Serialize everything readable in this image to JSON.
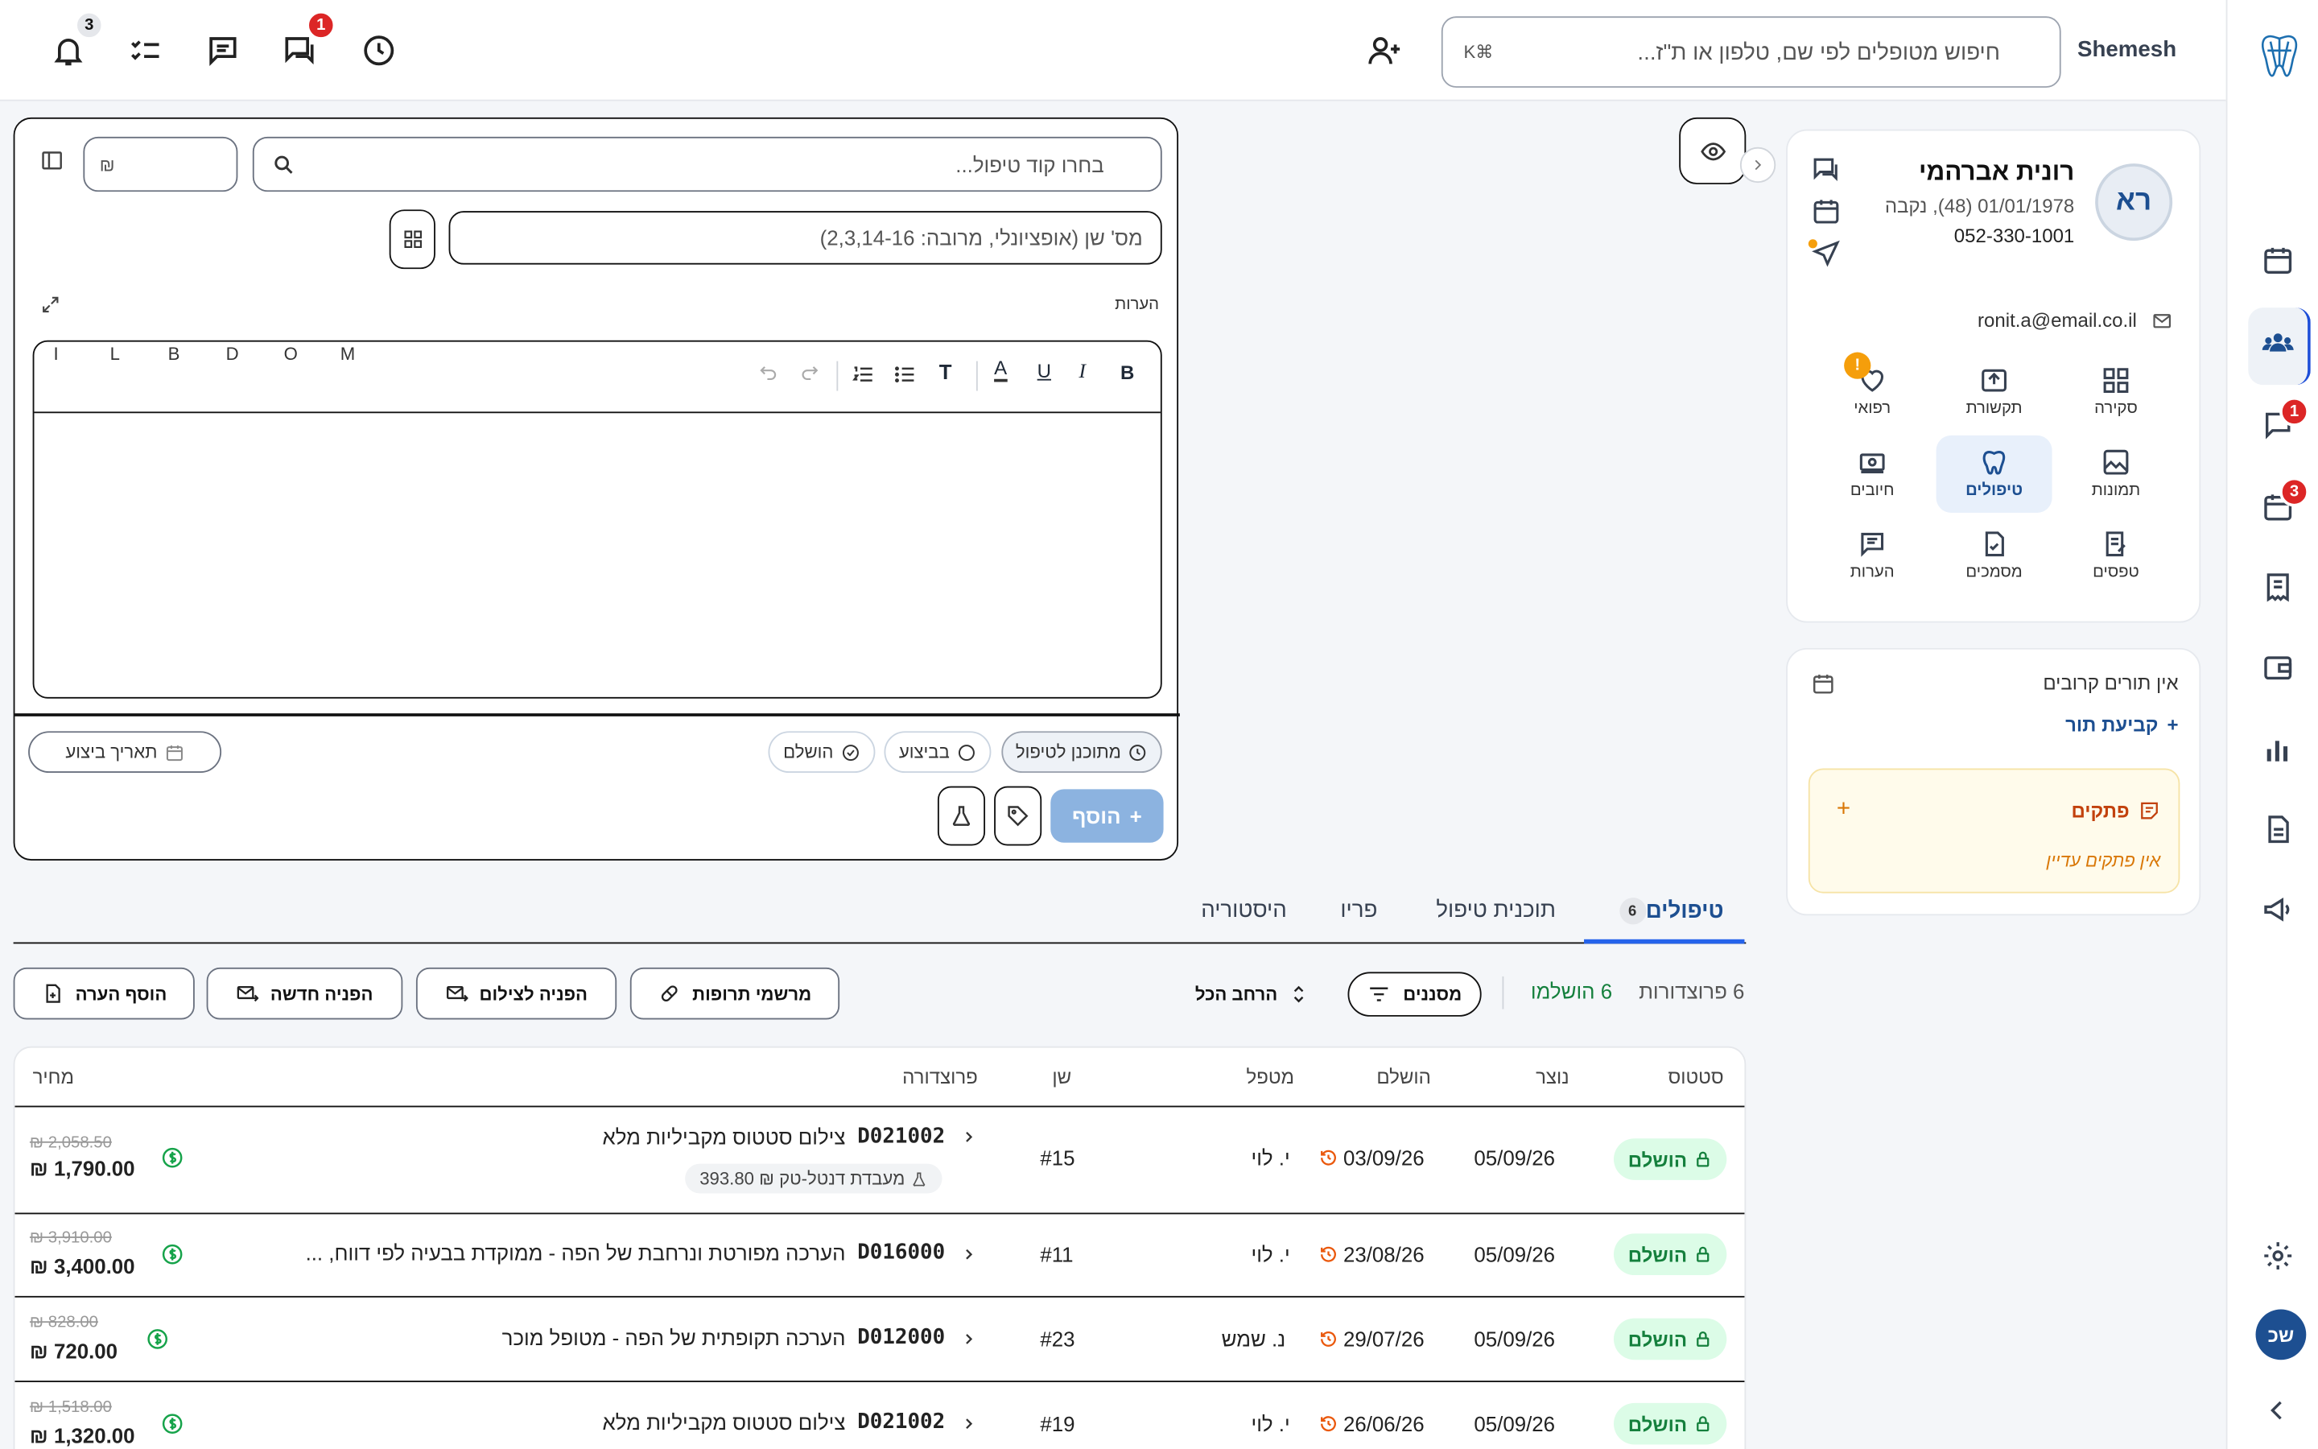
{
  "topbar": {
    "user_name": "Shemesh",
    "search_placeholder": "חיפוש מטופלים לפי שם, טלפון או ת\"ז...",
    "search_shortcut": "K⌘",
    "notifications_badge": "3",
    "messages_badge": "1"
  },
  "rail": {
    "messages_badge": "1",
    "reminders_badge": "3",
    "user_initials": "שכ"
  },
  "patient": {
    "initials": "רא",
    "name": "רונית אברהמי",
    "dob_line": "01/01/1978 (48), נקבה",
    "phone": "052-330-1001",
    "email": "ronit.a@email.co.il",
    "tiles": [
      {
        "label": "סקירה"
      },
      {
        "label": "תקשורת"
      },
      {
        "label": "רפואי"
      },
      {
        "label": "תמונות"
      },
      {
        "label": "טיפולים"
      },
      {
        "label": "חיובים"
      },
      {
        "label": "טפסים"
      },
      {
        "label": "מסמכים"
      },
      {
        "label": "הערות"
      }
    ],
    "medical_alert": "!"
  },
  "appointments": {
    "none_text": "אין תורים קרובים",
    "schedule_label": "קביעת תור",
    "notes_title": "פתקים",
    "notes_empty": "אין פתקים עדיין"
  },
  "form": {
    "code_placeholder": "בחרו קוד טיפול...",
    "price_placeholder": "₪",
    "tooth_placeholder": "מס' שן (אופציונלי, מרובה: 2,3,14-16)",
    "surfaces": [
      "M",
      "O",
      "D",
      "B",
      "L",
      "I"
    ],
    "notes_label": "הערות",
    "status_planned": "מתוכנן לטיפול",
    "status_in_progress": "בביצוע",
    "status_done": "הושלם",
    "date_placeholder": "תאריך ביצוע",
    "add_label": "הוסף"
  },
  "tabs": [
    {
      "label": "טיפולים",
      "count": "6"
    },
    {
      "label": "תוכנית טיפול"
    },
    {
      "label": "פריו"
    },
    {
      "label": "היסטוריה"
    }
  ],
  "summary": {
    "procedures": "6 פרוצדורות",
    "completed": "6 הושלמו",
    "filters_label": "מסננים",
    "expand_label": "הרחב הכל"
  },
  "actions": {
    "prescriptions": "מרשמי תרופות",
    "imaging_referral": "הפניה לצילום",
    "new_referral": "הפניה חדשה",
    "add_note": "הוסף הערה"
  },
  "table": {
    "headers": {
      "status": "סטטוס",
      "created": "נוצר",
      "completed": "הושלם",
      "provider": "מטפל",
      "tooth": "שן",
      "procedure": "פרוצדורה",
      "price": "מחיר"
    },
    "rows": [
      {
        "status": "הושלם",
        "created": "05/09/26",
        "completed": "03/09/26",
        "provider": "י. לוי",
        "tooth": "#15",
        "code": "D021002",
        "desc": "צילום סטטוס מקביליות מלא",
        "lab": "מעבדת דנטל-טק ₪ 393.80",
        "old_price": "₪ 2,058.50",
        "price": "₪ 1,790.00"
      },
      {
        "status": "הושלם",
        "created": "05/09/26",
        "completed": "23/08/26",
        "provider": "י. לוי",
        "tooth": "#11",
        "code": "D016000",
        "desc": "הערכה מפורטת ונרחבת של הפה - ממוקדת בבעיה לפי דווח, ...",
        "old_price": "₪ 3,910.00",
        "price": "₪ 3,400.00"
      },
      {
        "status": "הושלם",
        "created": "05/09/26",
        "completed": "29/07/26",
        "provider": "נ. שמש",
        "tooth": "#23",
        "code": "D012000",
        "desc": "הערכה תקופתית של הפה - מטופל מוכר",
        "old_price": "₪ 828.00",
        "price": "₪ 720.00"
      },
      {
        "status": "הושלם",
        "created": "05/09/26",
        "completed": "26/06/26",
        "provider": "י. לוי",
        "tooth": "#19",
        "code": "D021002",
        "desc": "צילום סטטוס מקביליות מלא",
        "old_price": "₪ 1,518.00",
        "price": "₪ 1,320.00"
      }
    ]
  }
}
